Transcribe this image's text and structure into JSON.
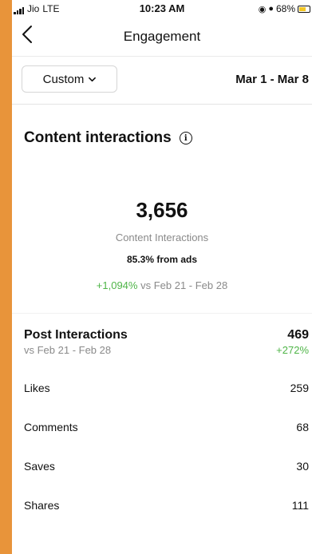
{
  "status_bar": {
    "carrier": "Jio",
    "network": "LTE",
    "time": "10:23 AM",
    "battery": "68%",
    "battery_level": 0.68,
    "battery_color": "#F3C623"
  },
  "nav": {
    "title": "Engagement",
    "back_icon": "chevron-left-icon"
  },
  "filter": {
    "dropdown_label": "Custom",
    "date_range": "Mar 1 - Mar 8"
  },
  "content_interactions": {
    "title": "Content interactions",
    "info_icon": "info-icon",
    "total": "3,656",
    "total_label": "Content Interactions",
    "from_ads": "85.3% from ads",
    "change": "+1,094%",
    "comparison": "vs Feb 21 - Feb 28"
  },
  "post_interactions": {
    "title": "Post Interactions",
    "comparison": "vs Feb 21 - Feb 28",
    "total": "469",
    "change": "+272%",
    "rows": [
      {
        "label": "Likes",
        "value": "259"
      },
      {
        "label": "Comments",
        "value": "68"
      },
      {
        "label": "Saves",
        "value": "30"
      },
      {
        "label": "Shares",
        "value": "111"
      }
    ]
  },
  "colors": {
    "accent_positive": "#4FB548",
    "frame": "#E8943A"
  }
}
